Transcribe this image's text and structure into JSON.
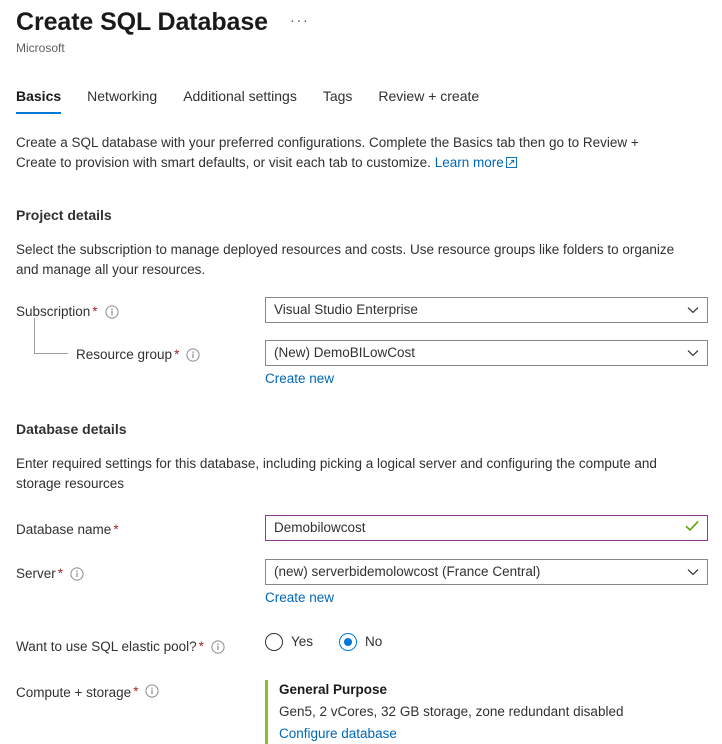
{
  "header": {
    "title": "Create SQL Database",
    "publisher": "Microsoft",
    "more_label": "···"
  },
  "tabs": [
    {
      "label": "Basics",
      "active": true
    },
    {
      "label": "Networking",
      "active": false
    },
    {
      "label": "Additional settings",
      "active": false
    },
    {
      "label": "Tags",
      "active": false
    },
    {
      "label": "Review + create",
      "active": false
    }
  ],
  "intro": {
    "text": "Create a SQL database with your preferred configurations. Complete the Basics tab then go to Review + Create to provision with smart defaults, or visit each tab to customize.",
    "link_label": "Learn more"
  },
  "project_details": {
    "section_title": "Project details",
    "description": "Select the subscription to manage deployed resources and costs. Use resource groups like folders to organize and manage all your resources.",
    "subscription": {
      "label": "Subscription",
      "required": "*",
      "value": "Visual Studio Enterprise"
    },
    "resource_group": {
      "label": "Resource group",
      "required": "*",
      "value": "(New) DemoBILowCost",
      "create_new_label": "Create new"
    }
  },
  "database_details": {
    "section_title": "Database details",
    "description": "Enter required settings for this database, including picking a logical server and configuring the compute and storage resources",
    "database_name": {
      "label": "Database name",
      "required": "*",
      "value": "Demobilowcost",
      "placeholder": "Enter database name",
      "valid": true
    },
    "server": {
      "label": "Server",
      "required": "*",
      "value": "(new) serverbidemolowcost (France Central)",
      "create_new_label": "Create new"
    },
    "elastic_pool": {
      "label": "Want to use SQL elastic pool?",
      "required": "*",
      "options": [
        {
          "label": "Yes",
          "selected": false
        },
        {
          "label": "No",
          "selected": true
        }
      ]
    },
    "compute_storage": {
      "label": "Compute + storage",
      "required": "*",
      "tier": "General Purpose",
      "specs": "Gen5, 2 vCores, 32 GB storage, zone redundant disabled",
      "configure_label": "Configure database"
    }
  },
  "colors": {
    "accent_blue": "#0078d4",
    "link_blue": "#0067b8",
    "required_red": "#a4262c",
    "tier_accent_green": "#8cbf26",
    "validated_border": "#8c3c8c",
    "valid_check_green": "#5ba300"
  }
}
